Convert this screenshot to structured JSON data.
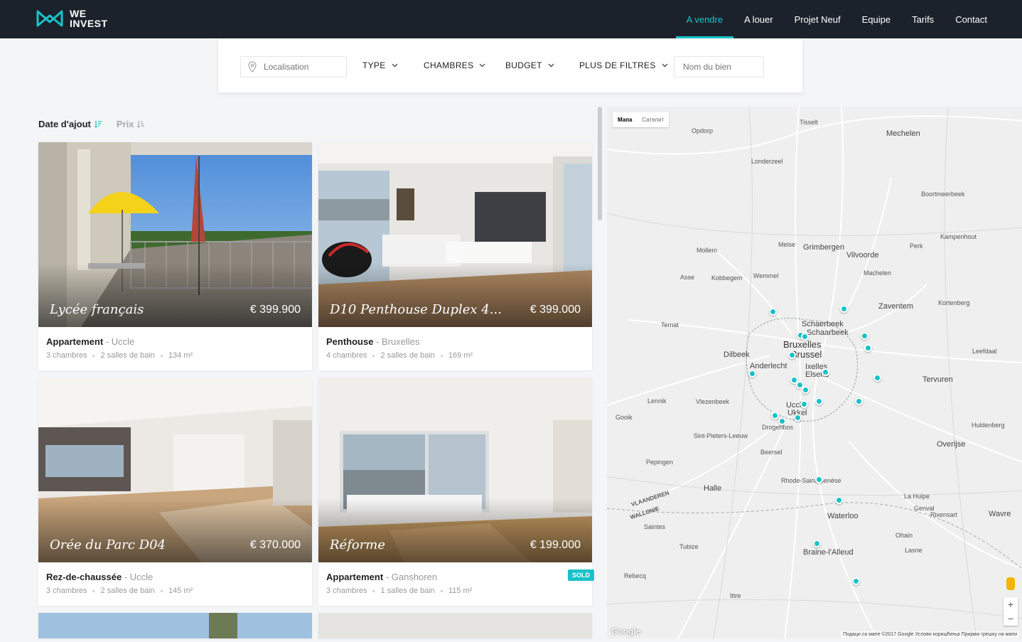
{
  "brand": {
    "line1": "WE",
    "line2": "INVEST",
    "accent": "#19c2c8"
  },
  "nav": [
    {
      "label": "A vendre",
      "active": true
    },
    {
      "label": "A louer"
    },
    {
      "label": "Projet Neuf"
    },
    {
      "label": "Equipe"
    },
    {
      "label": "Tarifs"
    },
    {
      "label": "Contact"
    }
  ],
  "filters": {
    "location_placeholder": "Localisation",
    "type": "TYPE",
    "rooms": "CHAMBRES",
    "budget": "BUDGET",
    "more": "PLUS DE FILTRES",
    "name_placeholder": "Nom du bien"
  },
  "sort": {
    "date": "Date d'ajout",
    "price": "Prix"
  },
  "listings": [
    {
      "title": "Lycée français",
      "price": "€ 399.900",
      "type": "Appartement",
      "location": "- Uccle",
      "rooms": "3 chambres",
      "baths": "2 salles de bain",
      "area": "134 m²"
    },
    {
      "title": "D10 Penthouse Duplex 4...",
      "price": "€ 399.000",
      "type": "Penthouse",
      "location": "- Bruxelles",
      "rooms": "4 chambres",
      "baths": "2 salles de bain",
      "area": "169 m²"
    },
    {
      "title": "Orée du Parc D04",
      "price": "€ 370.000",
      "type": "Rez-de-chaussée",
      "location": "- Uccle",
      "rooms": "3 chambres",
      "baths": "2 salles de bain",
      "area": "145 m²"
    },
    {
      "title": "Réforme",
      "price": "€ 199.000",
      "type": "Appartement",
      "location": "- Ganshoren",
      "rooms": "3 chambres",
      "baths": "1 salles de bain",
      "area": "115 m²",
      "badge": "SOLD"
    }
  ],
  "map": {
    "type_map": "Мапа",
    "type_sat": "Сателит",
    "labels": {
      "mechelen": "Mechelen",
      "vilvoorde": "Vilvoorde",
      "bruxelles": "Bruxelles",
      "brussel": "Brussel",
      "schaerbeek": "Schaerbeek",
      "schaarbeek": "Schaarbeek",
      "anderlecht": "Anderlecht",
      "ixelles": "Ixelles",
      "elsene": "Elsene",
      "uccle": "Uccle",
      "ukkel": "Ukkel",
      "zaventem": "Zaventem",
      "tervuren": "Tervuren",
      "waterloo": "Waterloo",
      "halle": "Halle",
      "dilbeek": "Dilbeek",
      "grimbergen": "Grimbergen",
      "braine": "Braine-l'Alleud",
      "overijse": "Overijse",
      "wavre": "Wavre",
      "meise": "Meise",
      "machelen": "Machelen",
      "wemmel": "Wemmel",
      "beersel": "Beersel",
      "tisselt": "Tisselt",
      "opdorp": "Opdorp",
      "londerzeel": "Londerzeel",
      "mollem": "Mollem",
      "asse": "Asse",
      "kobbegem": "Kobbegem",
      "lennik": "Lennik",
      "vlezenbeek": "Vlezenbeek",
      "drogenbos": "Drogenbos",
      "rhode": "Rhode-Saint-Genèse",
      "lahulpe": "La Hulpe",
      "genval": "Genval",
      "rixensart": "Rixensart",
      "lasne": "Lasne",
      "ohain": "Ohain",
      "rebecq": "Rebecq",
      "ittre": "Ittre",
      "tubize": "Tubize",
      "saintes": "Saintes",
      "leefdaal": "Leefdaal",
      "huldenberg": "Huldenberg",
      "perk": "Perk",
      "kortenberg": "Kortenberg",
      "kampenhout": "Kampenhout",
      "boortmeerbeek": "Boortmeerbeek",
      "sppl": "Sint-Pieters-Leeuw",
      "gooik": "Gooik",
      "pepingen": "Pepingen",
      "ternat": "Ternat",
      "vlaanderen": "VLAANDEREN",
      "wallonie": "WALLONIE"
    },
    "footer": "Подаци са мапе ©2017 Google   Услови коришћења   Пријави грешку на мапи",
    "google": "Google"
  }
}
